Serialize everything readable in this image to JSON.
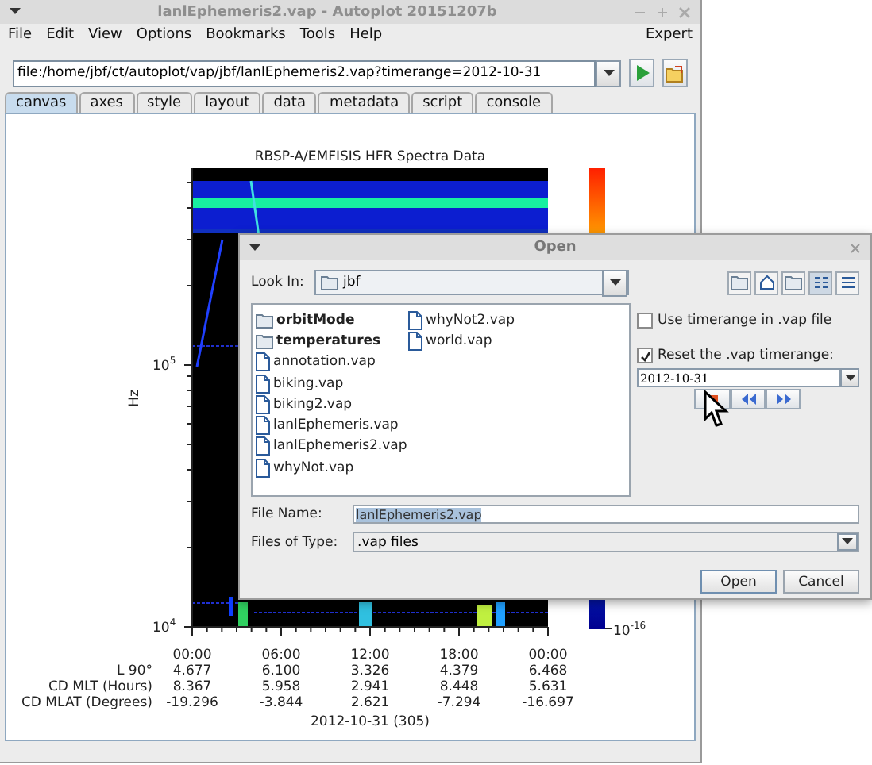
{
  "window": {
    "title": "lanlEphemeris2.vap - Autoplot 20151207b"
  },
  "menu": [
    "File",
    "Edit",
    "View",
    "Options",
    "Bookmarks",
    "Tools",
    "Help"
  ],
  "menu_right": "Expert",
  "address": {
    "value": "file:/home/jbf/ct/autoplot/vap/jbf/lanlEphemeris2.vap?timerange=2012-10-31"
  },
  "tabs": [
    {
      "label": "canvas",
      "selected": true
    },
    {
      "label": "axes",
      "selected": false
    },
    {
      "label": "style",
      "selected": false
    },
    {
      "label": "layout",
      "selected": false
    },
    {
      "label": "data",
      "selected": false
    },
    {
      "label": "metadata",
      "selected": false
    },
    {
      "label": "script",
      "selected": false
    },
    {
      "label": "console",
      "selected": false
    }
  ],
  "plot": {
    "title": "RBSP-A/EMFISIS HFR Spectra Data",
    "ylabel": "Hz",
    "yticks": [
      {
        "base": "10",
        "power": "5"
      },
      {
        "base": "10",
        "power": "4"
      }
    ],
    "colorbar_tick": {
      "base": "10",
      "power": "-16"
    },
    "xticks": [
      "00:00",
      "06:00",
      "12:00",
      "18:00",
      "00:00"
    ],
    "ephemeris": [
      {
        "label": "L 90°",
        "values": [
          "4.677",
          "6.100",
          "3.326",
          "4.379",
          "6.468"
        ]
      },
      {
        "label": "CD MLT (Hours)",
        "values": [
          "8.367",
          "5.958",
          "2.941",
          "8.448",
          "5.631"
        ]
      },
      {
        "label": "CD MLAT (Degrees)",
        "values": [
          "-19.296",
          "-3.844",
          "2.621",
          "-7.294",
          "-16.697"
        ]
      }
    ],
    "xlabel": "2012-10-31 (305)"
  },
  "dialog": {
    "title": "Open",
    "look_in": {
      "label": "Look In:",
      "value": "jbf"
    },
    "files": [
      {
        "name": "orbitMode",
        "kind": "folder"
      },
      {
        "name": "temperatures",
        "kind": "folder"
      },
      {
        "name": "annotation.vap",
        "kind": "file"
      },
      {
        "name": "biking.vap",
        "kind": "file"
      },
      {
        "name": "biking2.vap",
        "kind": "file"
      },
      {
        "name": "lanlEphemeris.vap",
        "kind": "file"
      },
      {
        "name": "lanlEphemeris2.vap",
        "kind": "file"
      },
      {
        "name": "whyNot.vap",
        "kind": "file"
      },
      {
        "name": "whyNot2.vap",
        "kind": "file"
      },
      {
        "name": "world.vap",
        "kind": "file"
      }
    ],
    "options": [
      {
        "label": "Use timerange in .vap file",
        "checked": false
      },
      {
        "label": "Reset the .vap timerange:",
        "checked": true
      }
    ],
    "timerange": "2012-10-31",
    "file_name": {
      "label": "File Name:",
      "value": "lanlEphemeris2.vap",
      "text_selected": true
    },
    "file_type": {
      "label": "Files of Type:",
      "value": ".vap files"
    },
    "buttons": [
      "Open",
      "Cancel"
    ]
  }
}
